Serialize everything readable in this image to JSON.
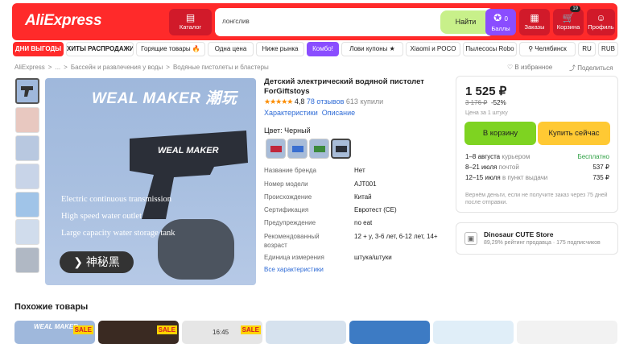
{
  "header": {
    "logo": "AliExpress",
    "catalog": "Каталог",
    "search_value": "лонгслив",
    "search_btn": "Найти",
    "points": "0",
    "points_label": "Баллы",
    "orders": "Заказы",
    "cart": "Корзина",
    "cart_count": "19",
    "profile": "Профиль"
  },
  "nav": [
    "ДНИ ВЫГОДЫ",
    "ХИТЫ РАСПРОДАЖИ",
    "Горящие товары 🔥",
    "Одна цена",
    "Ниже рынка",
    "Комбо!",
    "Лови купоны ★",
    "Xiaomi и POCO",
    "Пылесосы Robo",
    "Челябинск",
    "RU",
    "RUB"
  ],
  "breadcrumb": [
    "AliExpress",
    ">",
    "...",
    ">",
    "Бассейн и развлечения у воды",
    ">",
    "Водяные пистолеты и бластеры"
  ],
  "fav": "♡ В избранное",
  "share": "Поделиться",
  "image": {
    "brand": "WEAL MAKER 潮玩",
    "features": [
      "Electric continuous transmission",
      "High speed water outlet",
      "Large capacity water storage tank"
    ],
    "badge": "神秘黑",
    "gun_label": "WEAL MAKER"
  },
  "product": {
    "title": "Детский электрический водяной пистолет ForGiftstoys",
    "stars": "★★★★★",
    "rating": "4,8",
    "reviews": "78 отзывов",
    "bought": "613 купили",
    "tab1": "Характеристики",
    "tab2": "Описание",
    "color_label": "Цвет: Черный"
  },
  "specs": [
    [
      "Название бренда",
      "Нет"
    ],
    [
      "Номер модели",
      "AJT001"
    ],
    [
      "Происхождение",
      "Китай"
    ],
    [
      "Сертификация",
      "Евротест (CE)"
    ],
    [
      "Предупреждение",
      "no eat"
    ],
    [
      "Рекомендованный возраст",
      "12 + y, 3-6 лет, 6-12 лет, 14+"
    ],
    [
      "Единица измерения",
      "штука/штуки"
    ]
  ],
  "all_specs": "Все характеристики",
  "price": {
    "current": "1 525 ₽",
    "old": "3 176 ₽",
    "discount": "-52%",
    "note": "Цена за 1 штуку",
    "cart_btn": "В корзину",
    "buy_btn": "Купить сейчас"
  },
  "delivery": [
    {
      "date": "1–8 августа",
      "method": "курьером",
      "price": "Бесплатно"
    },
    {
      "date": "8–21 июля",
      "method": "почтой",
      "price": "537 ₽"
    },
    {
      "date": "12–15 июля",
      "method": "в пункт выдачи",
      "price": "735 ₽"
    }
  ],
  "return_note": "Вернём деньги, если не получите заказ через 75 дней после отправки.",
  "store": {
    "name": "Dinosaur CUTE Store",
    "rating": "89,29% рейтинг продавца · 175 подписчиков"
  },
  "similar": {
    "title": "Похожие товары",
    "sale": "SALE",
    "thumb_brand": "WEAL MAKER",
    "phone_time": "16:45"
  },
  "colors": {
    "accent": "#ff2a2a",
    "buy": "#ffc933",
    "cart": "#7ed321"
  }
}
